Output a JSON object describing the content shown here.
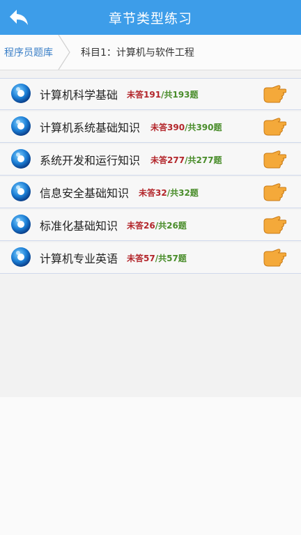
{
  "header": {
    "title": "章节类型练习"
  },
  "breadcrumb": {
    "root": "程序员题库",
    "current": "科目1：计算机与软件工程"
  },
  "chapters": [
    {
      "title": "计算机科学基础",
      "unanswered": "未答191",
      "sep": "/",
      "total": "共193题"
    },
    {
      "title": "计算机系统基础知识",
      "unanswered": "未答390",
      "sep": "/",
      "total": "共390题"
    },
    {
      "title": "系统开发和运行知识",
      "unanswered": "未答277",
      "sep": "/",
      "total": "共277题"
    },
    {
      "title": "信息安全基础知识",
      "unanswered": "未答32",
      "sep": "/",
      "total": "共32题"
    },
    {
      "title": "标准化基础知识",
      "unanswered": "未答26",
      "sep": "/",
      "total": "共26题"
    },
    {
      "title": "计算机专业英语",
      "unanswered": "未答57",
      "sep": "/",
      "total": "共57题"
    }
  ],
  "colors": {
    "header_bg": "#3d9de9",
    "unanswered": "#b3262b",
    "total": "#4a8d2b",
    "link": "#3a7fc7"
  },
  "icons": {
    "back": "back-arrow-icon",
    "chapter": "blue-orb-icon",
    "action": "pointing-hand-icon"
  }
}
